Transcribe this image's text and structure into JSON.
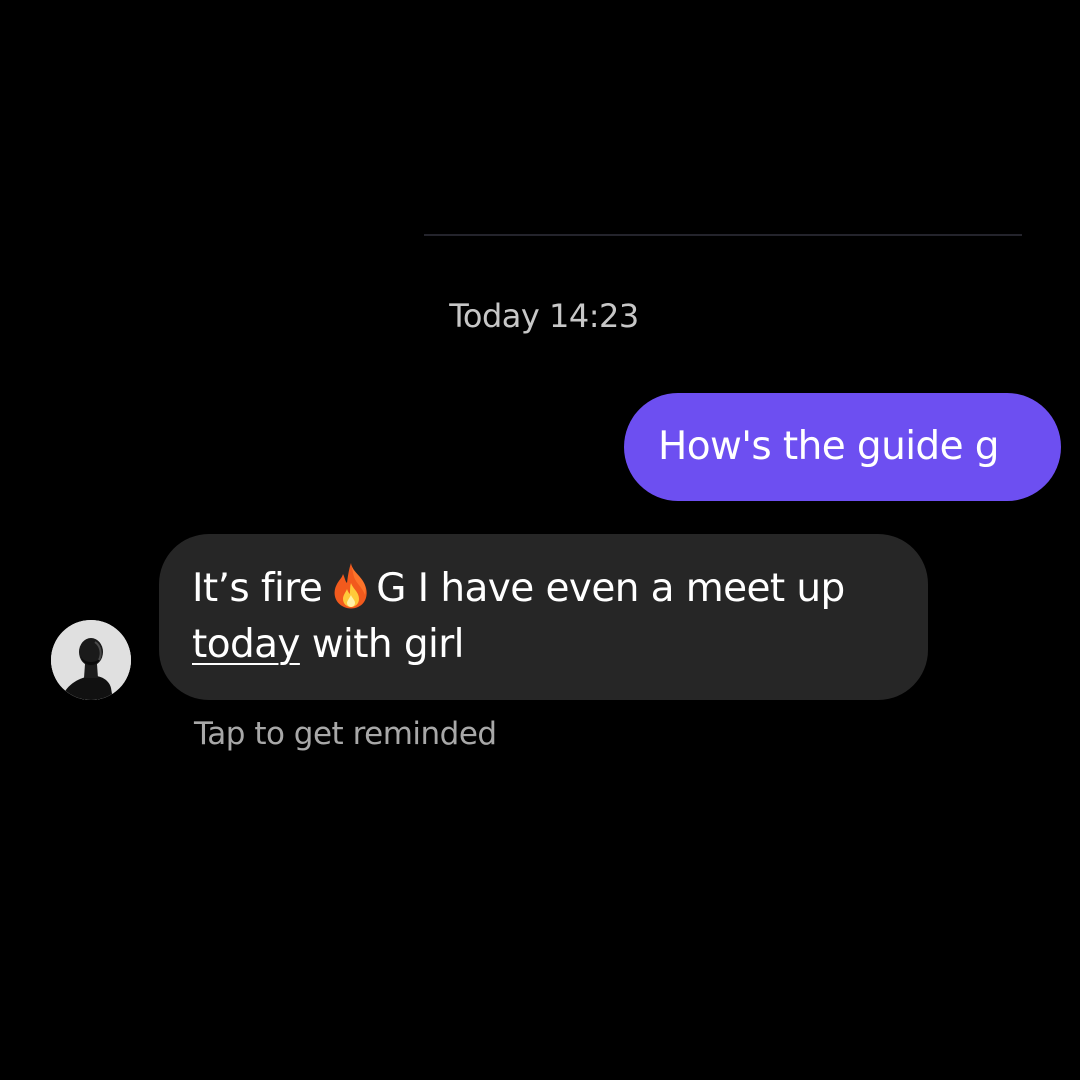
{
  "conversation": {
    "timestamp": "Today 14:23",
    "sent_message": {
      "text": "How's the guide g",
      "bubble_color": "#6d4ff1"
    },
    "received_message": {
      "line1_before_icon": "It’s fire",
      "icon": "fire-emoji",
      "line1_after_icon": "G I have even a meet up",
      "link_text": "today",
      "line2_after_link": " with girl",
      "bubble_color": "#262626"
    },
    "reminder_prompt": "Tap to get reminded",
    "sender_avatar": "avatar-photo"
  },
  "theme": {
    "background": "#000000",
    "text_primary": "#ffffff",
    "text_secondary": "#a8a8a8"
  }
}
